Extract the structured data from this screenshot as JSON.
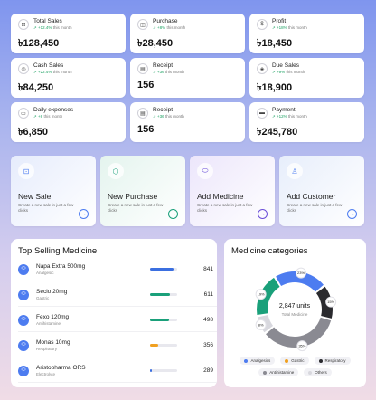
{
  "currency": "৳",
  "stats": [
    {
      "title": "Total Sales",
      "trend": "+12.4%",
      "trend_suffix": "this month",
      "value": "৳128,450",
      "icon": "cart-icon"
    },
    {
      "title": "Purchase",
      "trend": "+8%",
      "trend_suffix": "this month",
      "value": "৳28,450",
      "icon": "bag-icon"
    },
    {
      "title": "Profit",
      "trend": "+18%",
      "trend_suffix": "this month",
      "value": "৳18,450",
      "icon": "coin-icon"
    },
    {
      "title": "Cash Sales",
      "trend": "+22.4%",
      "trend_suffix": "this month",
      "value": "৳84,250",
      "icon": "cash-icon"
    },
    {
      "title": "Receipt",
      "trend": "+36",
      "trend_suffix": "this month",
      "value": "156",
      "icon": "receipt-icon"
    },
    {
      "title": "Due Sales",
      "trend": "+9%",
      "trend_suffix": "this month",
      "value": "৳18,900",
      "icon": "tag-icon"
    },
    {
      "title": "Daily expenses",
      "trend": "+8",
      "trend_suffix": "this month",
      "value": "৳6,850",
      "icon": "wallet-icon"
    },
    {
      "title": "Receipt",
      "trend": "+36",
      "trend_suffix": "this month",
      "value": "156",
      "icon": "receipt-icon"
    },
    {
      "title": "Payment",
      "trend": "+12%",
      "trend_suffix": "this month",
      "value": "৳245,780",
      "icon": "card-icon"
    }
  ],
  "actions": [
    {
      "title": "New Sale",
      "desc": "Create a new sale in just a few clicks",
      "icon": "cart-icon",
      "bg": "#e6ecfc",
      "accent": "#4d7cf0"
    },
    {
      "title": "New Purchase",
      "desc": "Create a new sale in just a few clicks",
      "icon": "box-icon",
      "bg": "#e4f4ee",
      "accent": "#1aa07a"
    },
    {
      "title": "Add Medicine",
      "desc": "Create a new sale in just a few clicks",
      "icon": "pill-icon",
      "bg": "#ece6fb",
      "accent": "#6b4fd8"
    },
    {
      "title": "Add Customer",
      "desc": "Create a new sale in just a few clicks",
      "icon": "user-plus-icon",
      "bg": "#e7eefb",
      "accent": "#4d7cf0"
    }
  ],
  "top_selling": {
    "title": "Top Selling Medicine",
    "items": [
      {
        "name": "Napa Extra 500mg",
        "category": "Analgesic",
        "count": "841",
        "level": 0.85,
        "color": "#3b6fe0"
      },
      {
        "name": "Secio 20mg",
        "category": "Gastric",
        "count": "611",
        "level": 0.72,
        "color": "#1aa07a"
      },
      {
        "name": "Fexo 120mg",
        "category": "Antihistamine",
        "count": "498",
        "level": 0.7,
        "color": "#1aa07a"
      },
      {
        "name": "Monas 10mg",
        "category": "Respiratory",
        "count": "356",
        "level": 0.3,
        "color": "#f0a020"
      },
      {
        "name": "Aristopharma ORS",
        "category": "Electrolyte",
        "count": "289",
        "level": 0.08,
        "color": "#3b6fe0"
      }
    ]
  },
  "categories": {
    "title": "Medicine categories",
    "total": "2,847 units",
    "total_label": "Total Medicine",
    "segments": [
      {
        "name": "Analgesics",
        "value": 23,
        "label": "23%",
        "color": "#4d7cf0"
      },
      {
        "name": "Respiratory",
        "value": 15,
        "label": "15%",
        "color": "#2a2a2e"
      },
      {
        "name": "Others",
        "value": 35,
        "label": "35%",
        "color": "#8a8a92"
      },
      {
        "name": "Antihistamine",
        "value": 8,
        "label": "8%",
        "color": "#d8d8de"
      },
      {
        "name": "Gastric",
        "value": 19,
        "label": "19%",
        "color": "#1aa07a"
      }
    ],
    "legend": [
      {
        "name": "Analgesics",
        "color": "#4d7cf0"
      },
      {
        "name": "Gastric",
        "color": "#f0a020"
      },
      {
        "name": "Respiratory",
        "color": "#2a2a2e"
      },
      {
        "name": "Antihistamine",
        "color": "#8a8a92"
      },
      {
        "name": "Others",
        "color": "#d8d8de"
      }
    ]
  }
}
